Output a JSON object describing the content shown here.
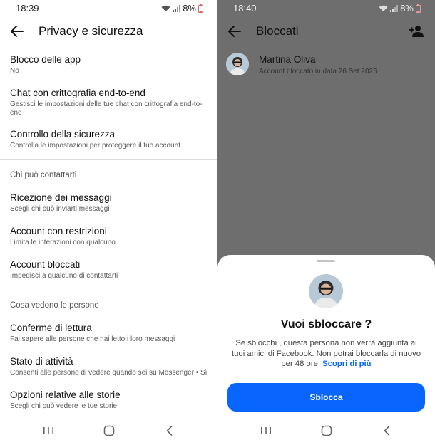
{
  "left": {
    "status": {
      "time": "18:39",
      "battery": "8%"
    },
    "title": "Privacy e sicurezza",
    "items_top": [
      {
        "title": "Blocco delle app",
        "subtitle": "No"
      },
      {
        "title": "Chat con crittografia end-to-end",
        "subtitle": "Gestisci le impostazioni delle tue chat con crittografia end-to-end"
      },
      {
        "title": "Controllo della sicurezza",
        "subtitle": "Controlla le impostazioni per proteggere il tuo account"
      }
    ],
    "section_contact": "Chi può contattarti",
    "items_contact": [
      {
        "title": "Ricezione dei messaggi",
        "subtitle": "Scegli chi può inviarti messaggi"
      },
      {
        "title": "Account con restrizioni",
        "subtitle": "Limita le interazioni con qualcuno"
      },
      {
        "title": "Account bloccati",
        "subtitle": "Impedisci a qualcuno di contattarti"
      }
    ],
    "section_see": "Cosa vedono le persone",
    "items_see": [
      {
        "title": "Conferme di lettura",
        "subtitle": "Fai sapere alle persone che hai letto i loro messaggi"
      },
      {
        "title": "Stato di attività",
        "subtitle": "Consenti alle persone di vedere quando sei su Messenger • Sì"
      },
      {
        "title": "Opzioni relative alle storie",
        "subtitle": "Scegli chi può vedere le tue storie"
      }
    ]
  },
  "right": {
    "status": {
      "time": "18:40",
      "battery": "8%"
    },
    "title": "Bloccati",
    "blocked_user": {
      "name": "Martina Oliva",
      "detail": "Account bloccato in data 26 Set 2025"
    },
    "sheet": {
      "title": "Vuoi sbloccare ?",
      "body": "Se sblocchi , questa persona non verrà aggiunta ai tuoi amici di Facebook. Non potrai bloccarla di nuovo per 48 ore.",
      "link": "Scopri di più",
      "button": "Sblocca"
    }
  },
  "icons": [
    "back-arrow-icon",
    "wifi-icon",
    "signal-icon",
    "battery-icon",
    "add-person-icon",
    "recents-icon",
    "home-icon",
    "back-nav-icon"
  ],
  "colors": {
    "accent": "#0866ff",
    "overlay": "#6e6e6e"
  }
}
